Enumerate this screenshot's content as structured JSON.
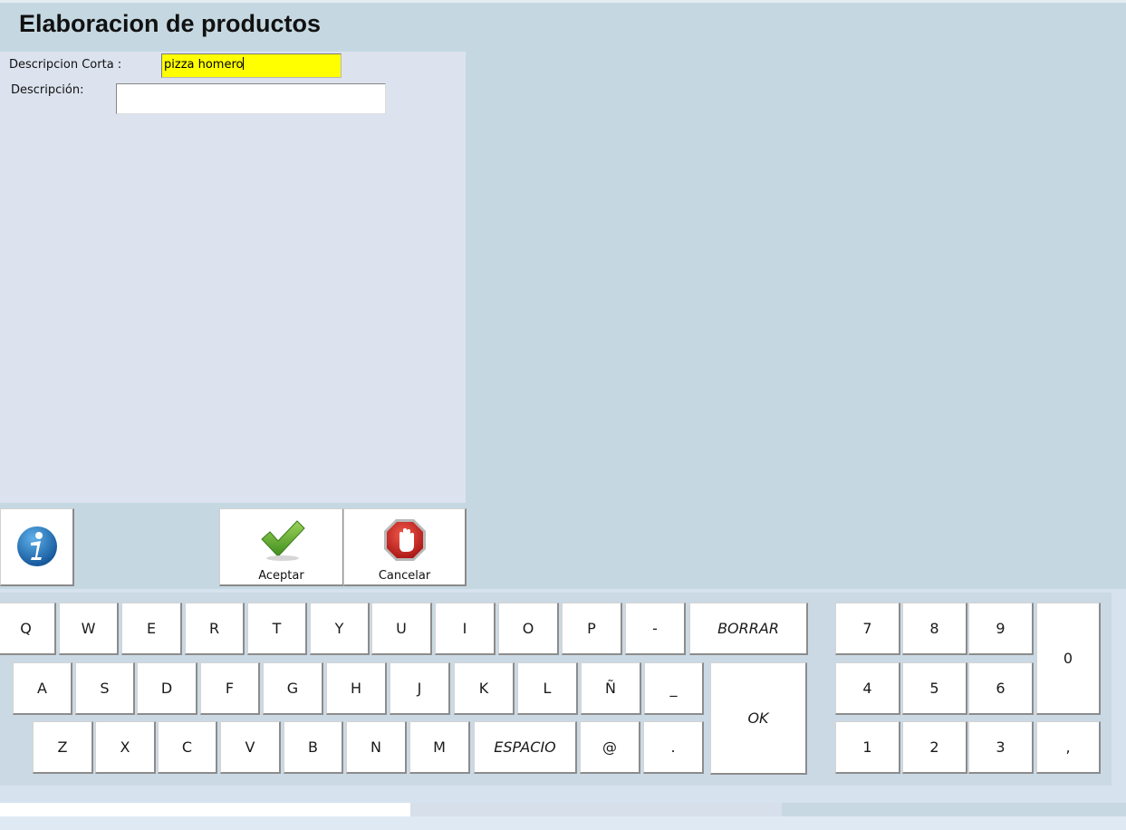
{
  "window": {
    "title": "Elaboracion de productos"
  },
  "form": {
    "short_label": "Descripcion Corta :",
    "short_value": "pizza homero",
    "desc_label": "Descripción:",
    "desc_value": ""
  },
  "actions": {
    "info_icon": "info-icon",
    "accept_label": "Aceptar",
    "cancel_label": "Cancelar"
  },
  "keyboard": {
    "row1": [
      "Q",
      "W",
      "E",
      "R",
      "T",
      "Y",
      "U",
      "I",
      "O",
      "P",
      "-"
    ],
    "row2": [
      "A",
      "S",
      "D",
      "F",
      "G",
      "H",
      "J",
      "K",
      "L",
      "Ñ",
      "_"
    ],
    "row3": [
      "Z",
      "X",
      "C",
      "V",
      "B",
      "N",
      "M"
    ],
    "delete_label": "BORRAR",
    "space_label": "ESPACIO",
    "at_label": "@",
    "dot_label": ".",
    "ok_label": "OK",
    "numpad": [
      "7",
      "8",
      "9",
      "4",
      "5",
      "6",
      "1",
      "2",
      "3"
    ],
    "zero_label": "0",
    "comma_label": ","
  },
  "colors": {
    "highlight_field": "#ffff00",
    "background": "#c5d8e2",
    "panel": "#dce3ee"
  }
}
